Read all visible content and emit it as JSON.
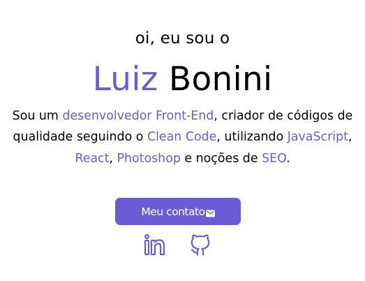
{
  "hero": {
    "greeting": "oi, eu sou o",
    "first_name": "Luiz",
    "last_name": "Bonini",
    "bio": {
      "t1": "Sou um ",
      "a1": "desenvolvedor Front-End",
      "t2": ", criador de códigos de qualidade seguindo o ",
      "a2": "Clean Code",
      "t3": ", utilizando ",
      "a3": "JavaScript",
      "t4": ", ",
      "a4": "React",
      "t5": ", ",
      "a5": "Photoshop",
      "t6": " e noções de ",
      "a6": "SEO",
      "t7": "."
    },
    "contact_label": "Meu contato"
  },
  "icons": {
    "contact": "mail-icon",
    "linkedin": "linkedin-icon",
    "github": "github-icon"
  },
  "colors": {
    "accent": "#6b5bd6",
    "text": "#000000",
    "background": "#ffffff"
  }
}
